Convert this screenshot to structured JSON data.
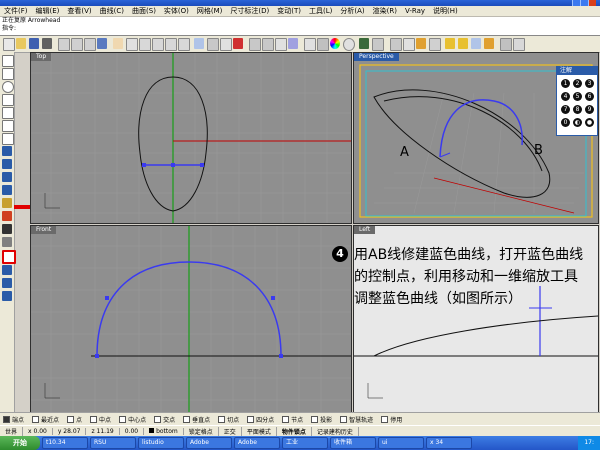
{
  "titlebar": {
    "buttons": [
      "minimize",
      "maximize",
      "close"
    ]
  },
  "menu": [
    "文件(F)",
    "编辑(E)",
    "查看(V)",
    "曲线(C)",
    "曲面(S)",
    "实体(O)",
    "网格(M)",
    "尺寸标注(D)",
    "变动(T)",
    "工具(L)",
    "分析(A)",
    "渲染(R)",
    "V-Ray",
    "说明(H)"
  ],
  "command": {
    "line1": "正在复原 Arrowhead",
    "line2": "指令:"
  },
  "viewports": {
    "top": "Top",
    "perspective": "Perspective",
    "front": "Front",
    "left": "Left"
  },
  "numpanel": {
    "title": "注解",
    "digits": [
      "1",
      "2",
      "3",
      "4",
      "5",
      "6",
      "7",
      "8",
      "9",
      "0",
      "◐",
      "●"
    ]
  },
  "labels": {
    "a": "A",
    "b": "B"
  },
  "annotation": {
    "number": "4",
    "text": "用AB线修建蓝色曲线，打开蓝色曲线的控制点，利用移动和一维缩放工具调整蓝色曲线（如图所示）"
  },
  "snaps": [
    {
      "label": "端点",
      "on": true
    },
    {
      "label": "最近点",
      "on": false
    },
    {
      "label": "点",
      "on": false
    },
    {
      "label": "中点",
      "on": false
    },
    {
      "label": "中心点",
      "on": false
    },
    {
      "label": "交点",
      "on": false
    },
    {
      "label": "垂直点",
      "on": false
    },
    {
      "label": "切点",
      "on": false
    },
    {
      "label": "四分点",
      "on": false
    },
    {
      "label": "节点",
      "on": false
    },
    {
      "label": "投影",
      "on": false
    },
    {
      "label": "智慧轨迹",
      "on": false
    },
    {
      "label": "停用",
      "on": false
    }
  ],
  "status": {
    "cplane": "世界",
    "x": "x 0.00",
    "y": "y 28.07",
    "z": "z 11.19",
    "unit": "0.00",
    "layer": "bottom",
    "lock": "锁定格点",
    "ortho": "正交",
    "planar": "平面模式",
    "osnap": "物件锁点",
    "history": "记录建构历史"
  },
  "taskbar": {
    "start": "开始",
    "tasks": [
      "t10.34",
      "RSU",
      "listudio",
      "Adobe",
      "Adobe",
      "工业",
      "收件箱",
      "ui",
      "x 34"
    ],
    "clock": "17:"
  },
  "colors": {
    "accent": "#2a5ba8",
    "curve_blue": "#3a3af0",
    "axis_red": "#c00000",
    "axis_green": "#00a000",
    "grid": "#8f8f8f",
    "arrow": "#e00000"
  }
}
